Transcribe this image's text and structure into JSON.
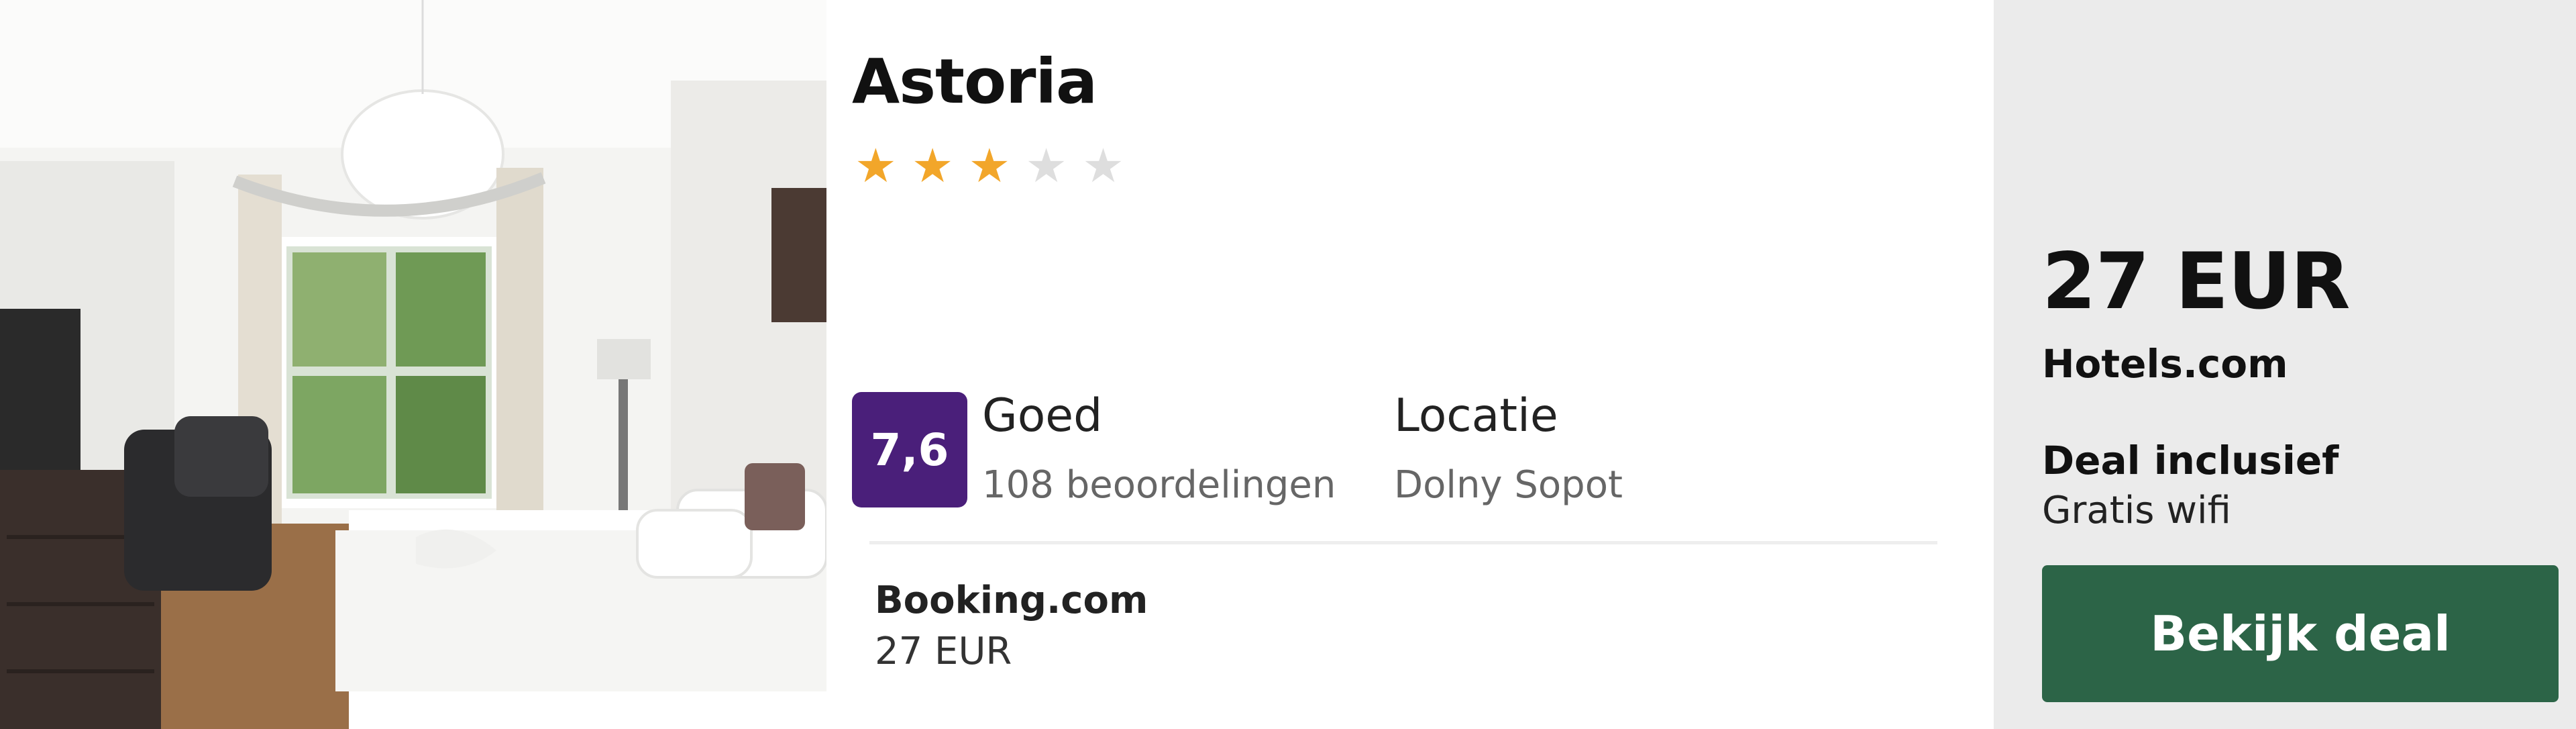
{
  "hotel": {
    "name": "Astoria",
    "stars_filled": 3,
    "stars_total": 5,
    "photo_subject": "hotel-room-bedroom-photo"
  },
  "rating": {
    "score": "7,6",
    "label": "Goed",
    "reviews": "108 beoordelingen"
  },
  "location": {
    "label": "Locatie",
    "value": "Dolny Sopot"
  },
  "offer": {
    "provider": "Booking.com",
    "price": "27 EUR"
  },
  "deal": {
    "price": "27 EUR",
    "source": "Hotels.com",
    "includes_label": "Deal inclusief",
    "includes_item": "Gratis wifi",
    "button_label": "Bekijk deal"
  },
  "colors": {
    "star_on": "#f2a62a",
    "star_off": "#dedede",
    "rating_badge": "#4a1f7a",
    "cta": "#2c6447",
    "price_panel": "#ebebeb"
  }
}
